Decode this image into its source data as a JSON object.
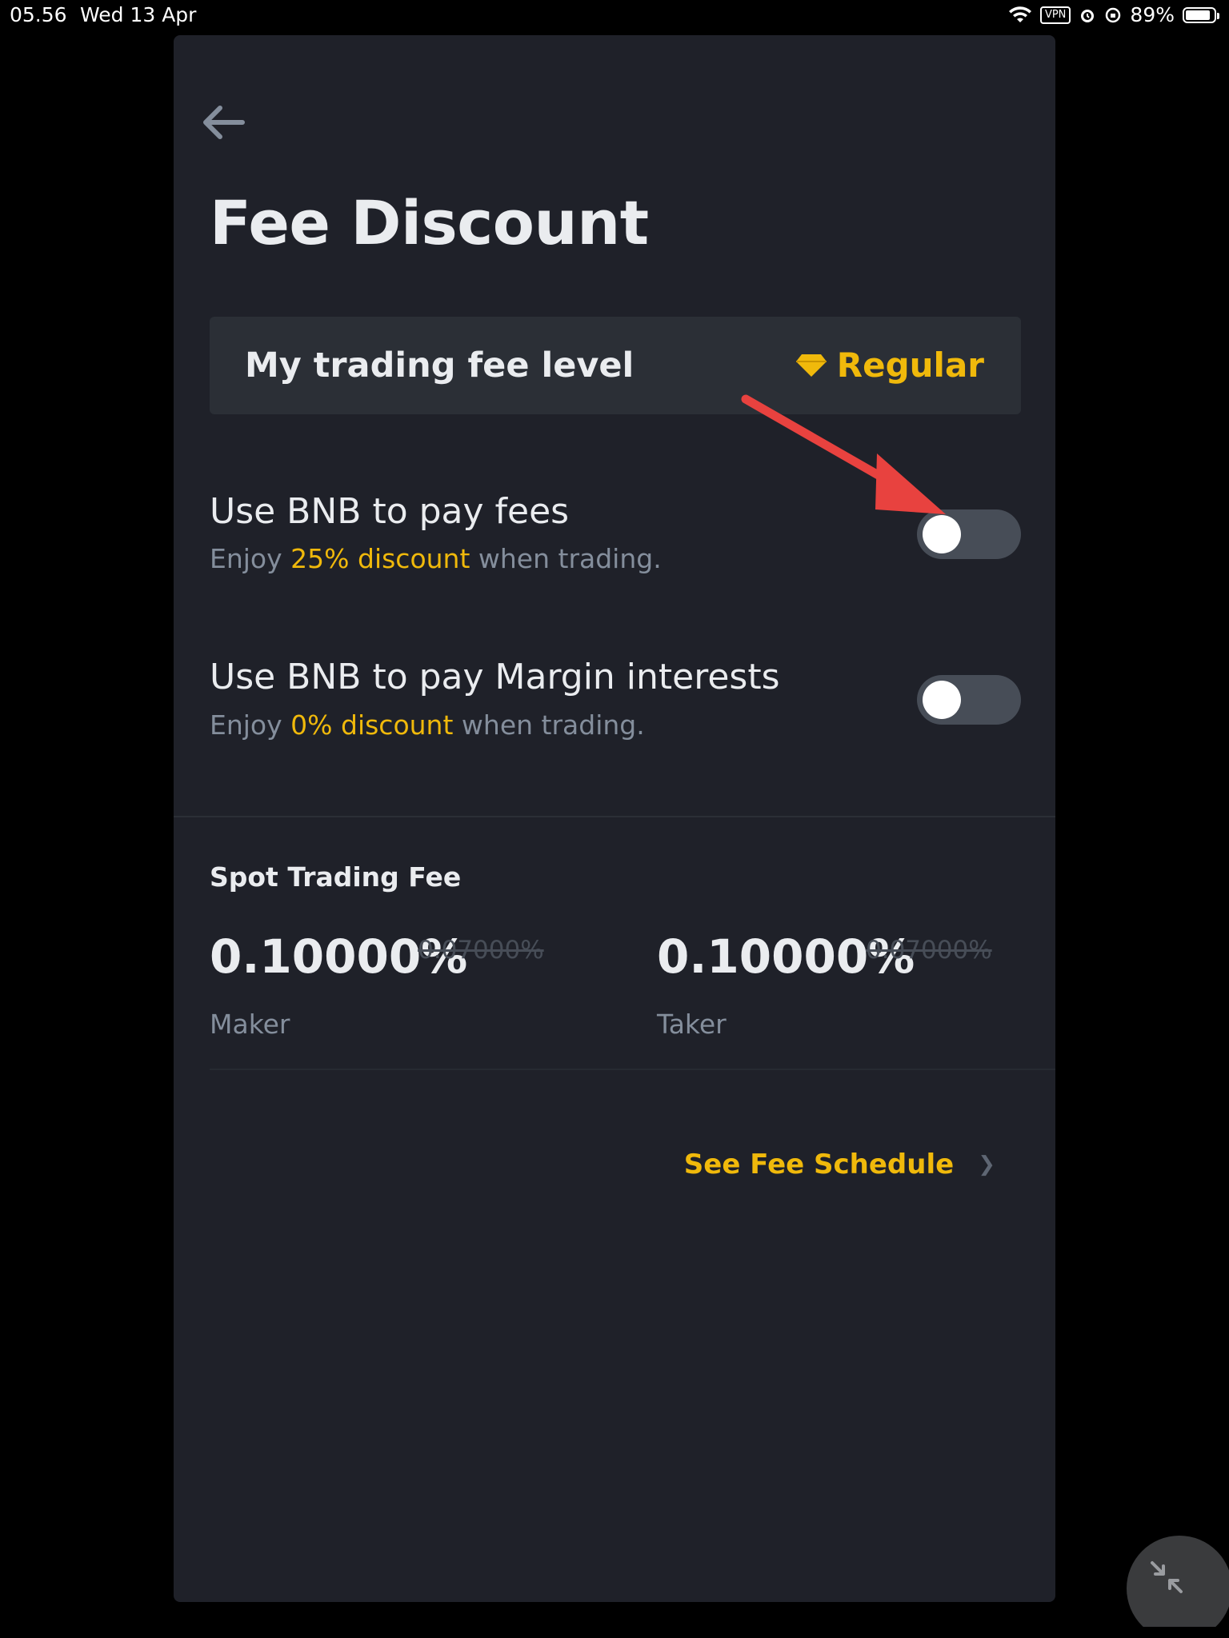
{
  "status_bar": {
    "time": "05.56",
    "date": "Wed 13 Apr",
    "vpn": "VPN",
    "battery": "89%",
    "battery_level": 0.89
  },
  "header": {
    "title": "Fee Discount"
  },
  "fee_level": {
    "label": "My trading fee level",
    "value": "Regular"
  },
  "options": [
    {
      "title": "Use BNB to pay fees",
      "sub_prefix": "Enjoy ",
      "sub_highlight": "25% discount",
      "sub_suffix": " when trading.",
      "enabled": false
    },
    {
      "title": "Use BNB to pay Margin interests",
      "sub_prefix": "Enjoy ",
      "sub_highlight": "0% discount",
      "sub_suffix": " when trading.",
      "enabled": false
    }
  ],
  "spot": {
    "title": "Spot Trading Fee",
    "maker": {
      "value": "0.10000%",
      "old": "0.07000%",
      "label": "Maker"
    },
    "taker": {
      "value": "0.10000%",
      "old": "0.07000%",
      "label": "Taker"
    }
  },
  "schedule_link": "See Fee Schedule",
  "colors": {
    "accent": "#F0B90B",
    "panel": "#1F2129",
    "annotation_arrow": "#E8423F"
  }
}
